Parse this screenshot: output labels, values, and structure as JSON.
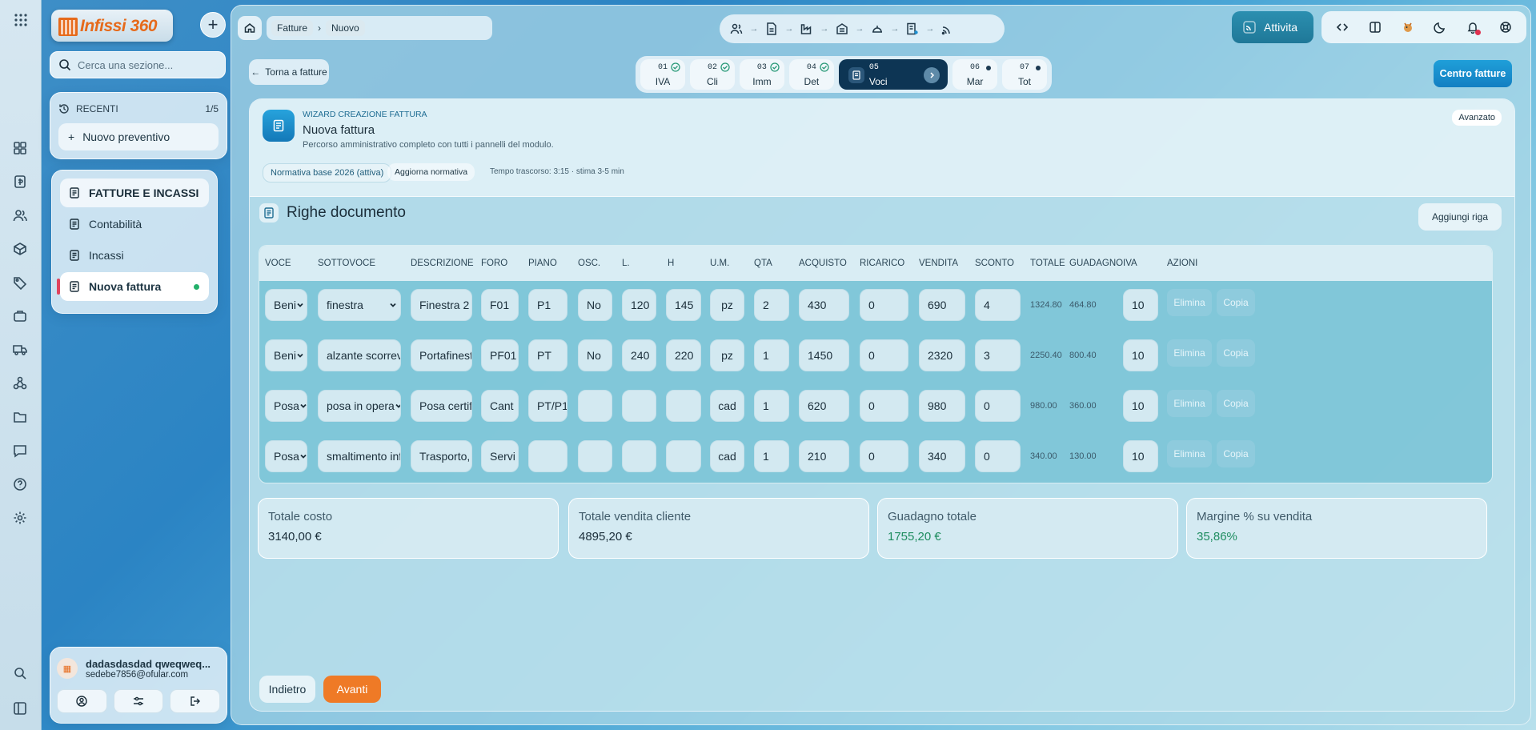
{
  "app": {
    "brand": "Infissi 360"
  },
  "sidebar": {
    "search_placeholder": "Cerca una sezione...",
    "recent_label": "RECENTI",
    "recent_count": "1/5",
    "recent_items": [
      {
        "label": "Nuovo preventivo"
      }
    ],
    "section_title": "FATTURE E INCASSI",
    "section_links": [
      {
        "label": "Contabilità"
      },
      {
        "label": "Incassi"
      },
      {
        "label": "Nuova fattura"
      }
    ],
    "user": {
      "name": "dadasdasdad qweqweq...",
      "email": "sedebe7856@ofular.com"
    }
  },
  "topbar": {
    "breadcrumb": [
      "Fatture",
      "Nuovo"
    ],
    "attivita_label": "Attivita"
  },
  "nav": {
    "back_label": "Torna a fatture",
    "centro_label": "Centro fatture"
  },
  "steps": [
    {
      "num": "01",
      "label": "IVA",
      "state": "done"
    },
    {
      "num": "02",
      "label": "Cli",
      "state": "done"
    },
    {
      "num": "03",
      "label": "Imm",
      "state": "done"
    },
    {
      "num": "04",
      "label": "Det",
      "state": "done"
    },
    {
      "num": "05",
      "label": "Voci",
      "state": "active"
    },
    {
      "num": "06",
      "label": "Mar",
      "state": "todo"
    },
    {
      "num": "07",
      "label": "Tot",
      "state": "todo"
    }
  ],
  "wizard": {
    "kicker": "WIZARD CREAZIONE FATTURA",
    "title": "Nuova fattura",
    "subtitle": "Percorso amministrativo completo con tutti i pannelli del modulo.",
    "normativa": "Normativa base 2026 (attiva)",
    "aggiorna": "Aggiorna normativa",
    "tempo": "Tempo trascorso: 3:15 · stima 3-5 min",
    "avanzato": "Avanzato"
  },
  "righe": {
    "title": "Righe documento",
    "add_label": "Aggiungi riga",
    "columns": [
      "VOCE",
      "SOTTOVOCE",
      "DESCRIZIONE",
      "FORO",
      "PIANO",
      "OSC.",
      "L.",
      "H",
      "U.M.",
      "QTA",
      "ACQUISTO",
      "RICARICO",
      "VENDITA",
      "SCONTO",
      "TOTALE",
      "GUADAGNO",
      "IVA",
      "AZIONI"
    ],
    "delete_label": "Elimina",
    "copy_label": "Copia",
    "rows": [
      {
        "voce": "Beni",
        "sottovoce": "finestra",
        "descrizione": "Finestra 2",
        "foro": "F01",
        "piano": "P1",
        "osc": "No",
        "l": "120",
        "h": "145",
        "um": "pz",
        "qta": "2",
        "acquisto": "430",
        "ricarico": "0",
        "vendita": "690",
        "sconto": "4",
        "totale": "1324.80",
        "guadagno": "464.80",
        "iva": "10"
      },
      {
        "voce": "Beni",
        "sottovoce": "alzante scorrevole",
        "descrizione": "Portafinestra",
        "foro": "PF01",
        "piano": "PT",
        "osc": "No",
        "l": "240",
        "h": "220",
        "um": "pz",
        "qta": "1",
        "acquisto": "1450",
        "ricarico": "0",
        "vendita": "2320",
        "sconto": "3",
        "totale": "2250.40",
        "guadagno": "800.40",
        "iva": "10"
      },
      {
        "voce": "Posa",
        "sottovoce": "posa in opera",
        "descrizione": "Posa certificata",
        "foro": "Cant",
        "piano": "PT/P1",
        "osc": "",
        "l": "",
        "h": "",
        "um": "cad",
        "qta": "1",
        "acquisto": "620",
        "ricarico": "0",
        "vendita": "980",
        "sconto": "0",
        "totale": "980.00",
        "guadagno": "360.00",
        "iva": "10"
      },
      {
        "voce": "Posa",
        "sottovoce": "smaltimento infissi",
        "descrizione": "Trasporto,",
        "foro": "Servi",
        "piano": "",
        "osc": "",
        "l": "",
        "h": "",
        "um": "cad",
        "qta": "1",
        "acquisto": "210",
        "ricarico": "0",
        "vendita": "340",
        "sconto": "0",
        "totale": "340.00",
        "guadagno": "130.00",
        "iva": "10"
      }
    ]
  },
  "summary": [
    {
      "label": "Totale costo",
      "value": "3140,00 €",
      "highlight": false
    },
    {
      "label": "Totale vendita cliente",
      "value": "4895,20 €",
      "highlight": false
    },
    {
      "label": "Guadagno totale",
      "value": "1755,20 €",
      "highlight": true
    },
    {
      "label": "Margine % su vendita",
      "value": "35,86%",
      "highlight": true
    }
  ],
  "footer": {
    "back_label": "Indietro",
    "next_label": "Avanti"
  },
  "colors": {
    "accent": "#1f8fd0",
    "orange": "#ef7a26",
    "active_step": "#0d3554",
    "profit": "#1f8d60"
  }
}
